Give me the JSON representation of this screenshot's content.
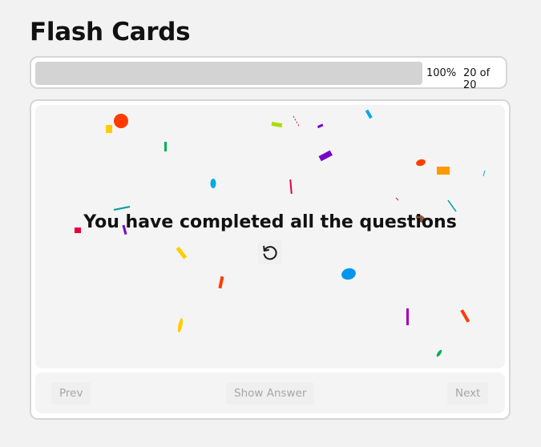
{
  "app": {
    "title": "Flash Cards"
  },
  "progress": {
    "percent_label": "100%",
    "count_label": "20 of 20",
    "fraction": 1.0
  },
  "card": {
    "message": "You have completed all the questions",
    "restart_icon": "restart-icon"
  },
  "controls": {
    "prev_label": "Prev",
    "show_answer_label": "Show Answer",
    "next_label": "Next"
  },
  "confetti_colors": [
    "#ff3b00",
    "#ffcc00",
    "#00b050",
    "#00aae6",
    "#7a00c8",
    "#ff9900",
    "#e6003c",
    "#0099a0",
    "#aadd00",
    "#8a5a44",
    "#0096f0"
  ]
}
